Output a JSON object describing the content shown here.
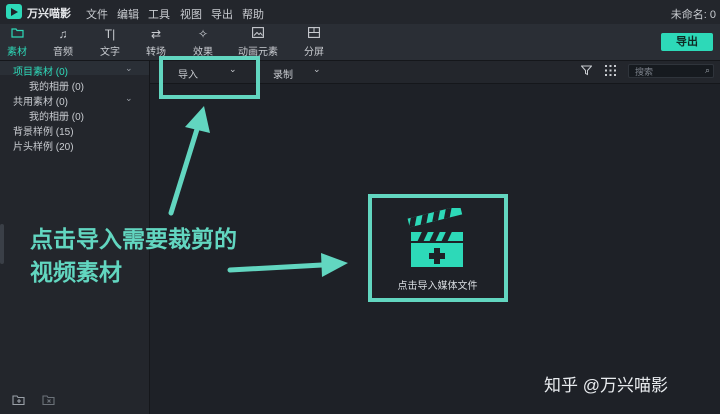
{
  "menubar": {
    "app_name": "万兴喵影",
    "items": [
      "文件",
      "编辑",
      "工具",
      "视图",
      "导出",
      "帮助"
    ],
    "project_name": "未命名: 0"
  },
  "toolbar": {
    "tools": [
      {
        "label": "素材",
        "icon": "folder-icon",
        "active": true
      },
      {
        "label": "音频",
        "icon": "music-note-icon"
      },
      {
        "label": "文字",
        "icon": "text-icon"
      },
      {
        "label": "转场",
        "icon": "transition-icon"
      },
      {
        "label": "效果",
        "icon": "effects-icon"
      },
      {
        "label": "动画元素",
        "icon": "image-icon"
      },
      {
        "label": "分屏",
        "icon": "split-screen-icon"
      }
    ],
    "export_label": "导出"
  },
  "sidebar": {
    "project_media": "项目素材 (0)",
    "project_album": "我的相册 (0)",
    "shared_media": "共用素材 (0)",
    "shared_album": "我的相册 (0)",
    "background_samples": "背景样例 (15)",
    "intro_samples": "片头样例 (20)"
  },
  "media_bar": {
    "import_label": "导入",
    "record_label": "录制",
    "search_placeholder": "搜索"
  },
  "import_area": {
    "label": "点击导入媒体文件"
  },
  "annotation": {
    "line1": "点击导入需要裁剪的",
    "line2": "视频素材"
  },
  "watermark": "知乎 @万兴喵影",
  "colors": {
    "accent": "#2dd9b8",
    "highlight": "#62d6c0",
    "background": "#1e2127"
  }
}
